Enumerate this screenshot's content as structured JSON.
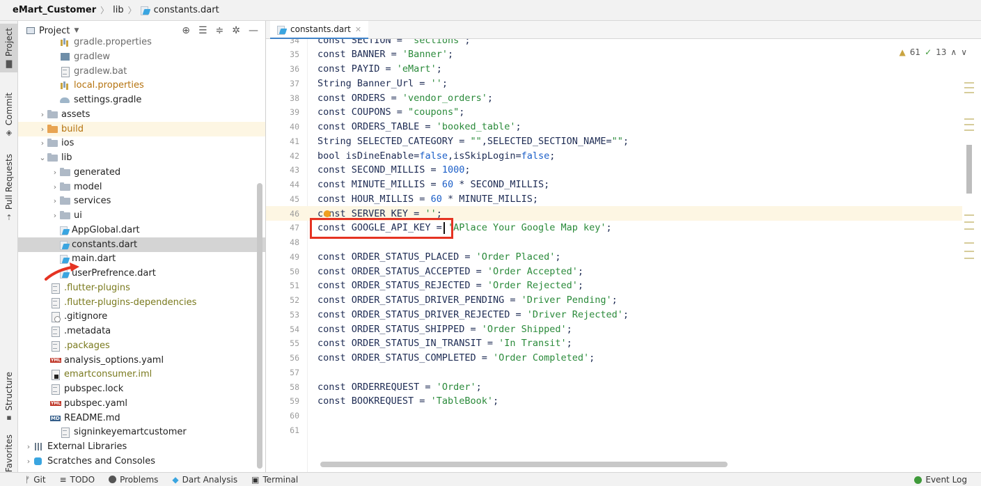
{
  "breadcrumb": {
    "project": "eMart_Customer",
    "folder": "lib",
    "file": "constants.dart"
  },
  "left_stripe": {
    "project": "Project",
    "commit": "Commit",
    "pull_requests": "Pull Requests",
    "structure": "Structure",
    "favorites": "Favorites"
  },
  "project_panel": {
    "title": "Project"
  },
  "tree": [
    {
      "label": "gradle.properties",
      "icon": "properties-icon",
      "style": "lbl-gray"
    },
    {
      "label": "gradlew",
      "icon": "executable-icon",
      "style": "lbl-gray"
    },
    {
      "label": "gradlew.bat",
      "icon": "file-icon",
      "style": "lbl-gray"
    },
    {
      "label": "local.properties",
      "icon": "properties-icon",
      "style": "lbl-orange"
    },
    {
      "label": "settings.gradle",
      "icon": "gradle-icon",
      "style": ""
    },
    {
      "label": "assets",
      "icon": "folder-icon",
      "style": ""
    },
    {
      "label": "build",
      "icon": "folder-icon",
      "style": "lbl-orange"
    },
    {
      "label": "ios",
      "icon": "folder-icon",
      "style": ""
    },
    {
      "label": "lib",
      "icon": "folder-icon",
      "style": ""
    },
    {
      "label": "generated",
      "icon": "folder-icon",
      "style": ""
    },
    {
      "label": "model",
      "icon": "folder-icon",
      "style": ""
    },
    {
      "label": "services",
      "icon": "folder-icon",
      "style": ""
    },
    {
      "label": "ui",
      "icon": "folder-icon",
      "style": ""
    },
    {
      "label": "AppGlobal.dart",
      "icon": "dart-file-icon",
      "style": ""
    },
    {
      "label": "constants.dart",
      "icon": "dart-file-icon",
      "style": ""
    },
    {
      "label": "main.dart",
      "icon": "dart-file-icon",
      "style": ""
    },
    {
      "label": "userPrefrence.dart",
      "icon": "dart-file-icon",
      "style": ""
    },
    {
      "label": ".flutter-plugins",
      "icon": "file-icon",
      "style": "lbl-olive"
    },
    {
      "label": ".flutter-plugins-dependencies",
      "icon": "file-icon",
      "style": "lbl-olive"
    },
    {
      "label": ".gitignore",
      "icon": "gitignore-icon",
      "style": ""
    },
    {
      "label": ".metadata",
      "icon": "file-icon",
      "style": ""
    },
    {
      "label": ".packages",
      "icon": "file-icon",
      "style": "lbl-olive"
    },
    {
      "label": "analysis_options.yaml",
      "icon": "yaml-icon",
      "style": ""
    },
    {
      "label": "emartconsumer.iml",
      "icon": "iml-icon",
      "style": "lbl-olive"
    },
    {
      "label": "pubspec.lock",
      "icon": "file-icon",
      "style": ""
    },
    {
      "label": "pubspec.yaml",
      "icon": "yaml-icon",
      "style": ""
    },
    {
      "label": "README.md",
      "icon": "markdown-icon",
      "style": ""
    },
    {
      "label": "signinkeyemartcustomer",
      "icon": "file-icon",
      "style": ""
    },
    {
      "label": "External Libraries",
      "icon": "library-icon",
      "style": ""
    },
    {
      "label": "Scratches and Consoles",
      "icon": "scratch-icon",
      "style": ""
    }
  ],
  "editor": {
    "tab_label": "constants.dart",
    "inspections": {
      "warnings": "61",
      "weak_warnings": "13"
    },
    "lines": [
      {
        "n": "34",
        "code": "const SECTION = 'sections';"
      },
      {
        "n": "35",
        "code": "const BANNER = 'Banner';"
      },
      {
        "n": "36",
        "code": "const PAYID = 'eMart';"
      },
      {
        "n": "37",
        "code": "String Banner_Url = '';"
      },
      {
        "n": "38",
        "code": "const ORDERS = 'vendor_orders';"
      },
      {
        "n": "39",
        "code": "const COUPONS = \"coupons\";"
      },
      {
        "n": "40",
        "code": "const ORDERS_TABLE = 'booked_table';"
      },
      {
        "n": "41",
        "code": "String SELECTED_CATEGORY = \"\",SELECTED_SECTION_NAME=\"\";"
      },
      {
        "n": "42",
        "code": "bool isDineEnable=false,isSkipLogin=false;"
      },
      {
        "n": "43",
        "code": "const SECOND_MILLIS = 1000;"
      },
      {
        "n": "44",
        "code": "const MINUTE_MILLIS = 60 * SECOND_MILLIS;"
      },
      {
        "n": "45",
        "code": "const HOUR_MILLIS = 60 * MINUTE_MILLIS;"
      },
      {
        "n": "46",
        "code": "const SERVER_KEY = '';"
      },
      {
        "n": "47",
        "code": "const GOOGLE_API_KEY = 'APlace Your Google Map key';"
      },
      {
        "n": "48",
        "code": ""
      },
      {
        "n": "49",
        "code": "const ORDER_STATUS_PLACED = 'Order Placed';"
      },
      {
        "n": "50",
        "code": "const ORDER_STATUS_ACCEPTED = 'Order Accepted';"
      },
      {
        "n": "51",
        "code": "const ORDER_STATUS_REJECTED = 'Order Rejected';"
      },
      {
        "n": "52",
        "code": "const ORDER_STATUS_DRIVER_PENDING = 'Driver Pending';"
      },
      {
        "n": "53",
        "code": "const ORDER_STATUS_DRIVER_REJECTED = 'Driver Rejected';"
      },
      {
        "n": "54",
        "code": "const ORDER_STATUS_SHIPPED = 'Order Shipped';"
      },
      {
        "n": "55",
        "code": "const ORDER_STATUS_IN_TRANSIT = 'In Transit';"
      },
      {
        "n": "56",
        "code": "const ORDER_STATUS_COMPLETED = 'Order Completed';"
      },
      {
        "n": "57",
        "code": ""
      },
      {
        "n": "58",
        "code": "const ORDERREQUEST = 'Order';"
      },
      {
        "n": "59",
        "code": "const BOOKREQUEST = 'TableBook';"
      },
      {
        "n": "60",
        "code": ""
      },
      {
        "n": "61",
        "code": ""
      }
    ]
  },
  "status_bar": {
    "git": "Git",
    "todo": "TODO",
    "problems": "Problems",
    "dart_analysis": "Dart Analysis",
    "terminal": "Terminal",
    "event_log": "Event Log"
  },
  "colors": {
    "highlight_box": "#e53322",
    "string": "#2a8a3a",
    "number": "#1c5fc8",
    "selection": "#d4d4d4"
  }
}
